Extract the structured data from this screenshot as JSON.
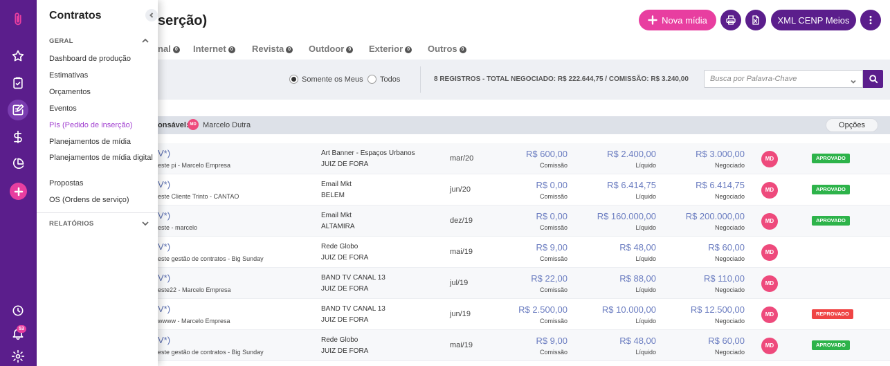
{
  "rail": {
    "notifications_count": "53",
    "icons": [
      "paperclip-icon",
      "star-icon",
      "clipboard-check-icon",
      "edit-document-icon",
      "dollar-icon",
      "pie-chart-icon",
      "plus-icon",
      "clock-icon",
      "bell-icon",
      "gear-icon"
    ]
  },
  "menu": {
    "title": "Contratos",
    "section_geral": "GERAL",
    "section_relatorios": "RELATÓRIOS",
    "items": [
      {
        "label": "Dashboard de produção"
      },
      {
        "label": "Estimativas"
      },
      {
        "label": "Orçamentos"
      },
      {
        "label": "Eventos"
      },
      {
        "label": "PIs (Pedido de inserção)"
      },
      {
        "label": "Planejamentos de mídia"
      },
      {
        "label": "Planejamentos de mídia digital"
      },
      {
        "label": "Propostas"
      },
      {
        "label": "OS (Ordens de serviço)"
      }
    ]
  },
  "header": {
    "title": "serção)",
    "new_media_label": "Nova mídia",
    "xml_label": "XML CENP Meios"
  },
  "tabs": [
    {
      "label": "nal",
      "count": "0"
    },
    {
      "label": "Internet",
      "count": "0"
    },
    {
      "label": "Revista",
      "count": "0"
    },
    {
      "label": "Outdoor",
      "count": "0"
    },
    {
      "label": "Exterior",
      "count": "0"
    },
    {
      "label": "Outros",
      "count": "0"
    }
  ],
  "filters": {
    "only_mine": "Somente os Meus",
    "all": "Todos",
    "selected": "only_mine",
    "summary": "8 REGISTROS - TOTAL NEGOCIADO: R$ 222.644,75 / COMISSÃO: R$ 3.240,00",
    "search_placeholder": "Busca por Palavra-Chave"
  },
  "group": {
    "responsavel_label": "onsável:",
    "avatar": "MD",
    "name": "Marcelo Dutra",
    "options_label": "Opções"
  },
  "labels": {
    "comissao": "Comissão",
    "liquido": "Líquido",
    "negociado": "Negociado"
  },
  "colors": {
    "primary": "#5b1e8c",
    "accent": "#e83ea0",
    "approved": "#2db34a",
    "rejected": "#ef4444"
  },
  "rows": [
    {
      "title": "V*)",
      "sub": "este pi - Marcelo Empresa",
      "vehicle": "Art Banner - Espaços Urbanos",
      "city": "JUIZ DE FORA",
      "date": "mar/20",
      "comissao": "R$ 600,00",
      "liquido": "R$ 2.400,00",
      "negociado": "R$ 3.000,00",
      "avatar": "MD",
      "status": "APROVADO",
      "status_type": "approved"
    },
    {
      "title": "V*)",
      "sub": "este Cliente Trinto - CANTAO",
      "vehicle": "Email Mkt",
      "city": "BELEM",
      "date": "jun/20",
      "comissao": "R$ 0,00",
      "liquido": "R$ 6.414,75",
      "negociado": "R$ 6.414,75",
      "avatar": "MD",
      "status": "APROVADO",
      "status_type": "approved"
    },
    {
      "title": "V*)",
      "sub": "este - marcelo",
      "vehicle": "Email Mkt",
      "city": "ALTAMIRA",
      "date": "dez/19",
      "comissao": "R$ 0,00",
      "liquido": "R$ 160.000,00",
      "negociado": "R$ 200.000,00",
      "avatar": "MD",
      "status": "APROVADO",
      "status_type": "approved"
    },
    {
      "title": "V*)",
      "sub": "este gestão de contratos - Big Sunday",
      "vehicle": "Rede Globo",
      "city": "JUIZ DE FORA",
      "date": "mai/19",
      "comissao": "R$ 9,00",
      "liquido": "R$ 48,00",
      "negociado": "R$ 60,00",
      "avatar": "MD",
      "status": "",
      "status_type": "none"
    },
    {
      "title": "V*)",
      "sub": "este22 - Marcelo Empresa",
      "vehicle": "BAND TV CANAL 13",
      "city": "JUIZ DE FORA",
      "date": "jul/19",
      "comissao": "R$ 22,00",
      "liquido": "R$ 88,00",
      "negociado": "R$ 110,00",
      "avatar": "MD",
      "status": "",
      "status_type": "none"
    },
    {
      "title": "V*)",
      "sub": "wwww - Marcelo Empresa",
      "vehicle": "BAND TV CANAL 13",
      "city": "JUIZ DE FORA",
      "date": "jun/19",
      "comissao": "R$ 2.500,00",
      "liquido": "R$ 10.000,00",
      "negociado": "R$ 12.500,00",
      "avatar": "MD",
      "status": "REPROVADO",
      "status_type": "rejected"
    },
    {
      "title": "V*)",
      "sub": "este gestão de contratos - Big Sunday",
      "vehicle": "Rede Globo",
      "city": "JUIZ DE FORA",
      "date": "mai/19",
      "comissao": "R$ 9,00",
      "liquido": "R$ 48,00",
      "negociado": "R$ 60,00",
      "avatar": "MD",
      "status": "APROVADO",
      "status_type": "approved"
    }
  ]
}
